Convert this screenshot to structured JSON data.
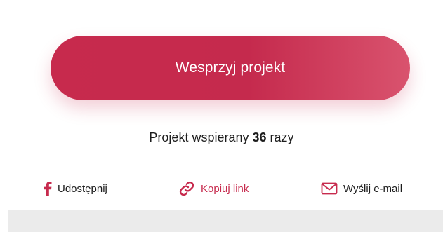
{
  "support": {
    "button_label": "Wesprzyj projekt"
  },
  "supported": {
    "prefix": "Projekt wspierany",
    "count": "36",
    "suffix": "razy"
  },
  "share": {
    "facebook_label": "Udostępnij",
    "copy_link_label": "Kopiuj link",
    "email_label": "Wyślij e-mail"
  },
  "colors": {
    "accent": "#c72a4d",
    "text": "#1c1c1c",
    "band": "#ebebeb"
  },
  "icons": [
    "facebook-icon",
    "link-icon",
    "mail-icon"
  ]
}
